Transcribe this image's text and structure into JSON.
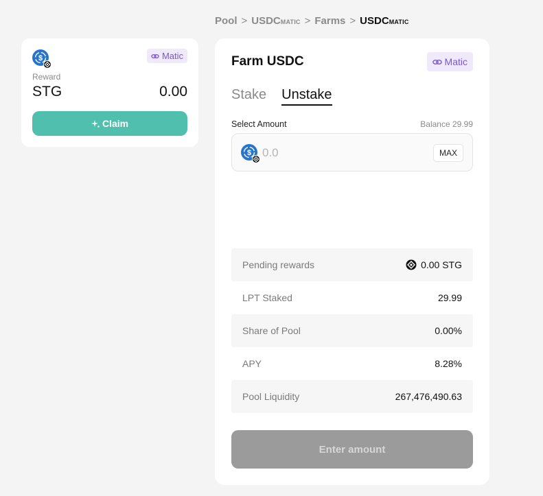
{
  "breadcrumb": {
    "pool": "Pool",
    "sep": ">",
    "usdc_main": "USDC",
    "usdc_sub": "MATIC",
    "farms": "Farms",
    "current_main": "USDC",
    "current_sub": "MATIC"
  },
  "reward_card": {
    "chip_label": "Matic",
    "reward_label": "Reward",
    "token": "STG",
    "amount": "0.00",
    "claim_label": "Claim",
    "claim_icon": "sparkle-icon"
  },
  "main_card": {
    "title": "Farm USDC",
    "chip_label": "Matic",
    "tabs": [
      {
        "label": "Stake",
        "active": false
      },
      {
        "label": "Unstake",
        "active": true
      }
    ],
    "select_label": "Select Amount",
    "balance": "Balance 29.99",
    "amount_input": {
      "value": "",
      "placeholder": "0.0"
    },
    "max_label": "MAX",
    "stats": [
      {
        "label": "Pending rewards",
        "value": "0.00 STG",
        "icon": "stg-token-icon"
      },
      {
        "label": "LPT Staked",
        "value": "29.99"
      },
      {
        "label": "Share of Pool",
        "value": "0.00%"
      },
      {
        "label": "APY",
        "value": "8.28%"
      },
      {
        "label": "Pool Liquidity",
        "value": "267,476,490.63"
      }
    ],
    "submit_label": "Enter amount"
  },
  "colors": {
    "accent_teal": "#51bfad",
    "usdc_blue": "#2775ca",
    "matic_purple": "#7b55d4",
    "disabled_gray": "#9b9b9b"
  }
}
